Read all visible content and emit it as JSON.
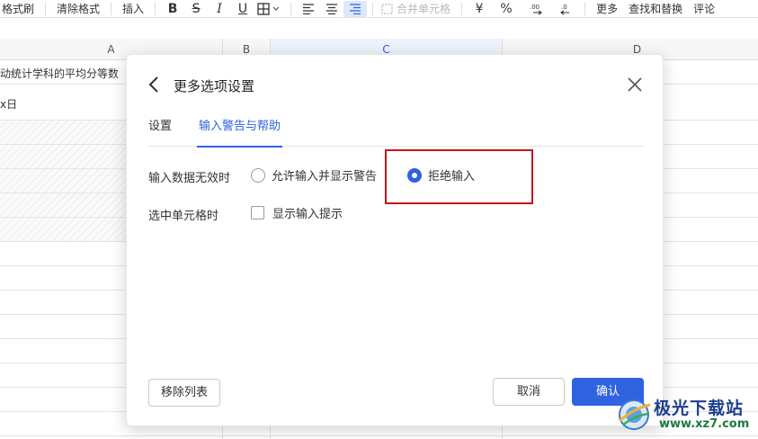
{
  "toolbar": {
    "format_painter": "格式刷",
    "clear_format": "清除格式",
    "insert": "插入",
    "merge_cells": "合并单元格",
    "currency_symbol": "¥",
    "percent_symbol": "%",
    "more": "更多",
    "find_replace": "查找和替换",
    "comment": "评论"
  },
  "sheet": {
    "columns": [
      "A",
      "B",
      "C",
      "D"
    ],
    "selected_column": "C",
    "cells": {
      "a1": "动统计学科的平均分等数",
      "a2": "x日"
    }
  },
  "dialog": {
    "title": "更多选项设置",
    "tabs": [
      {
        "label": "设置",
        "active": false
      },
      {
        "label": "输入警告与帮助",
        "active": true
      }
    ],
    "invalid_data": {
      "label": "输入数据无效时",
      "options": [
        {
          "label": "允许输入并显示警告",
          "checked": false
        },
        {
          "label": "拒绝输入",
          "checked": true
        }
      ]
    },
    "on_select": {
      "label": "选中单元格时",
      "checkbox": {
        "label": "显示输入提示",
        "checked": false
      }
    },
    "remove_list_button": "移除列表",
    "cancel_button": "取消",
    "confirm_button": "确认"
  },
  "colors": {
    "accent": "#2f63e0",
    "highlight_border": "#c3171c"
  },
  "watermark": {
    "name": "极光下载站",
    "url": "www.xz7.com"
  }
}
